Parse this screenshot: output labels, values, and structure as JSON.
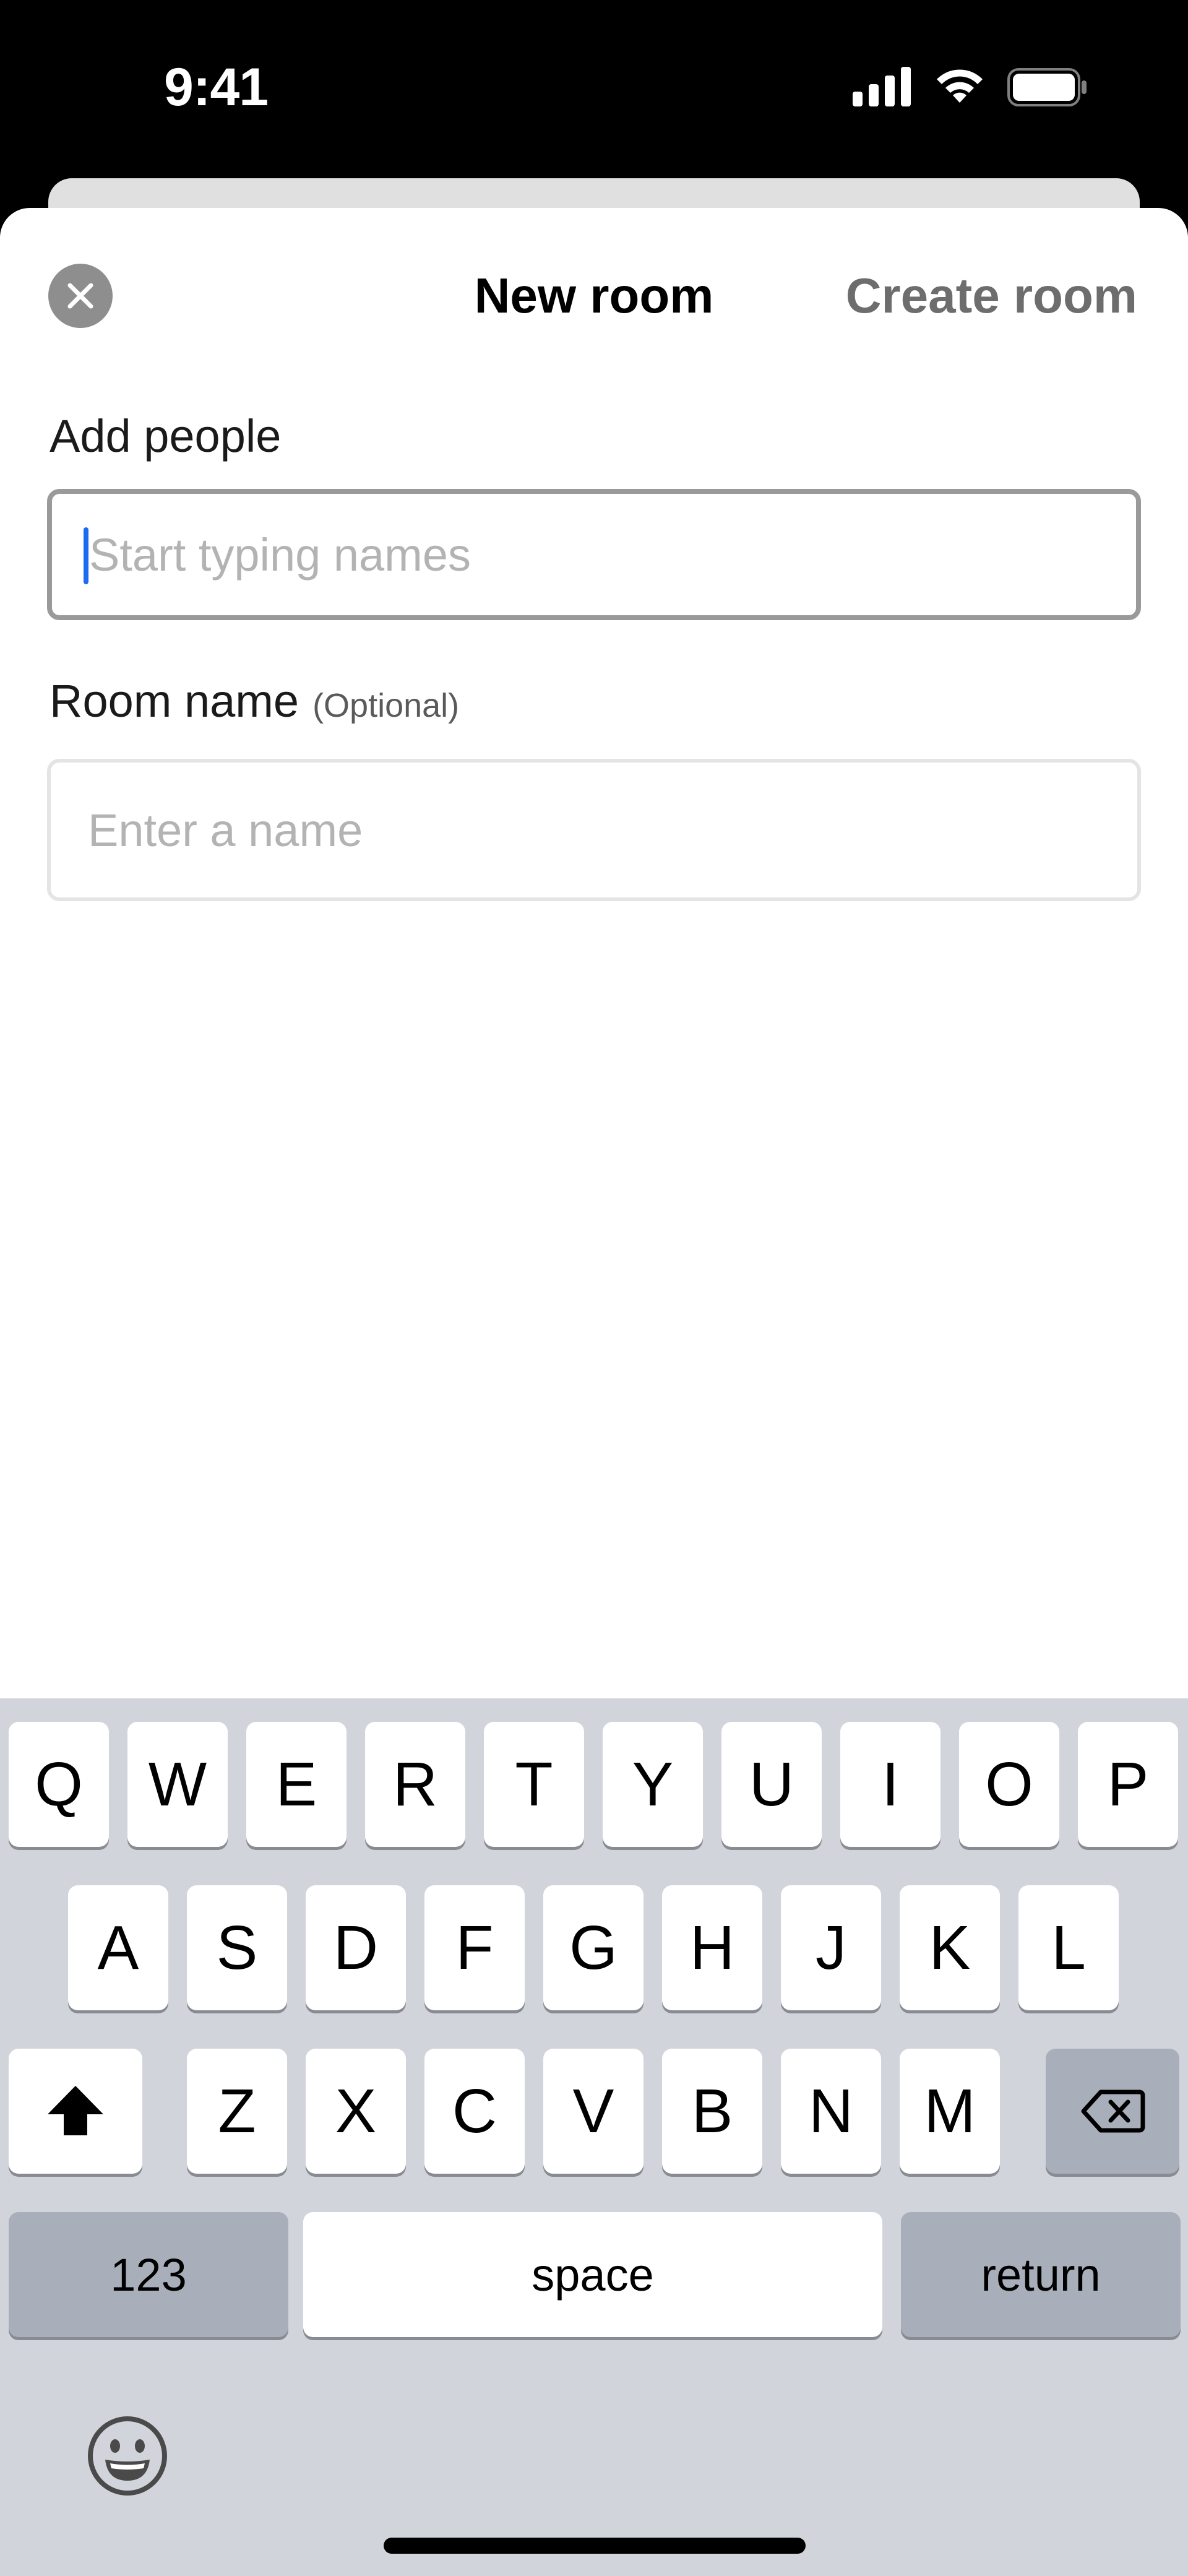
{
  "status_bar": {
    "time": "9:41"
  },
  "header": {
    "title": "New room",
    "create_label": "Create room"
  },
  "form": {
    "people_label": "Add people",
    "people_placeholder": "Start typing names",
    "room_label": "Room name",
    "room_optional": "(Optional)",
    "room_placeholder": "Enter a name"
  },
  "keyboard": {
    "row1": [
      "Q",
      "W",
      "E",
      "R",
      "T",
      "Y",
      "U",
      "I",
      "O",
      "P"
    ],
    "row2": [
      "A",
      "S",
      "D",
      "F",
      "G",
      "H",
      "J",
      "K",
      "L"
    ],
    "row3": [
      "Z",
      "X",
      "C",
      "V",
      "B",
      "N",
      "M"
    ],
    "numbers_label": "123",
    "space_label": "space",
    "return_label": "return"
  }
}
